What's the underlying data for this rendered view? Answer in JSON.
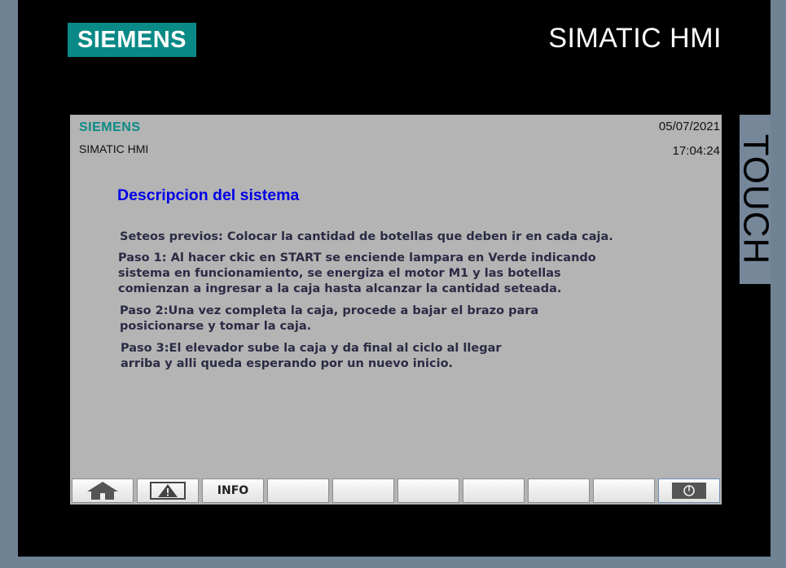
{
  "device": {
    "brand": "SIEMENS",
    "product": "SIMATIC HMI",
    "side_label": "TOUCH"
  },
  "header": {
    "logo": "SIEMENS",
    "subtitle": "SIMATIC HMI",
    "date": "05/07/2021",
    "time": "17:04:24"
  },
  "main": {
    "title": "Descripcion del sistema",
    "paragraphs": [
      [
        "Seteos previos: Colocar la cantidad de botellas que deben ir en cada caja."
      ],
      [
        "Paso 1: Al hacer ckic en START se enciende lampara en Verde indicando",
        "sistema en funcionamiento, se energiza el motor M1 y las botellas",
        "comienzan a ingresar a la caja hasta alcanzar la cantidad seteada."
      ],
      [
        "Paso 2:Una vez completa la caja, procede a bajar el brazo para",
        "posicionarse y tomar la caja."
      ],
      [
        "Paso 3:El elevador sube la caja y da final al ciclo al llegar",
        "arriba y alli queda esperando por un nuevo inicio."
      ]
    ]
  },
  "softkeys": {
    "info_label": "INFO",
    "icons": {
      "home": "home-icon",
      "alarm": "warning-icon",
      "power": "power-icon"
    },
    "colors": {
      "icon": "#555555"
    }
  },
  "colors": {
    "siemens_teal": "#0a8a87",
    "title_blue": "#0000e6",
    "screen_bg": "#b4b4b4",
    "frame": "#6f8395",
    "bezel": "#000000"
  }
}
